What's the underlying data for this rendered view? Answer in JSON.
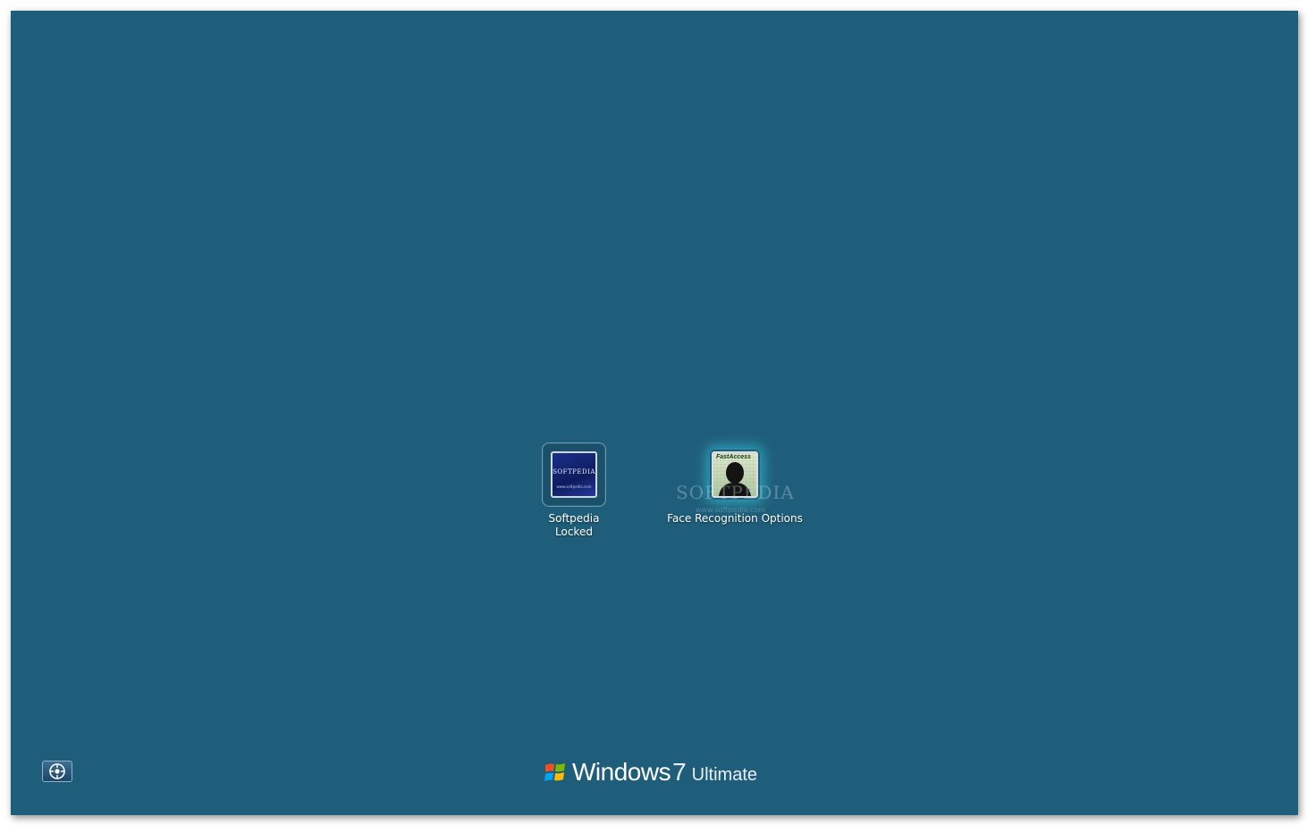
{
  "users": [
    {
      "name": "Softpedia",
      "status": "Locked",
      "picture_text": "SOFTPEDIA",
      "picture_url": "www.softpedia.com"
    },
    {
      "name": "Face Recognition Options",
      "picture_text": "FastAccess"
    }
  ],
  "watermark": {
    "text": "SOFTPEDIA",
    "url": "www.softpedia.com"
  },
  "branding": {
    "product": "Windows",
    "version": "7",
    "edition": "Ultimate"
  },
  "colors": {
    "background": "#1f5e7a",
    "glow": "#3cdcf0"
  },
  "icons": {
    "ease_of_access": "ease-of-access-icon",
    "windows_logo": "windows-flag-icon"
  }
}
